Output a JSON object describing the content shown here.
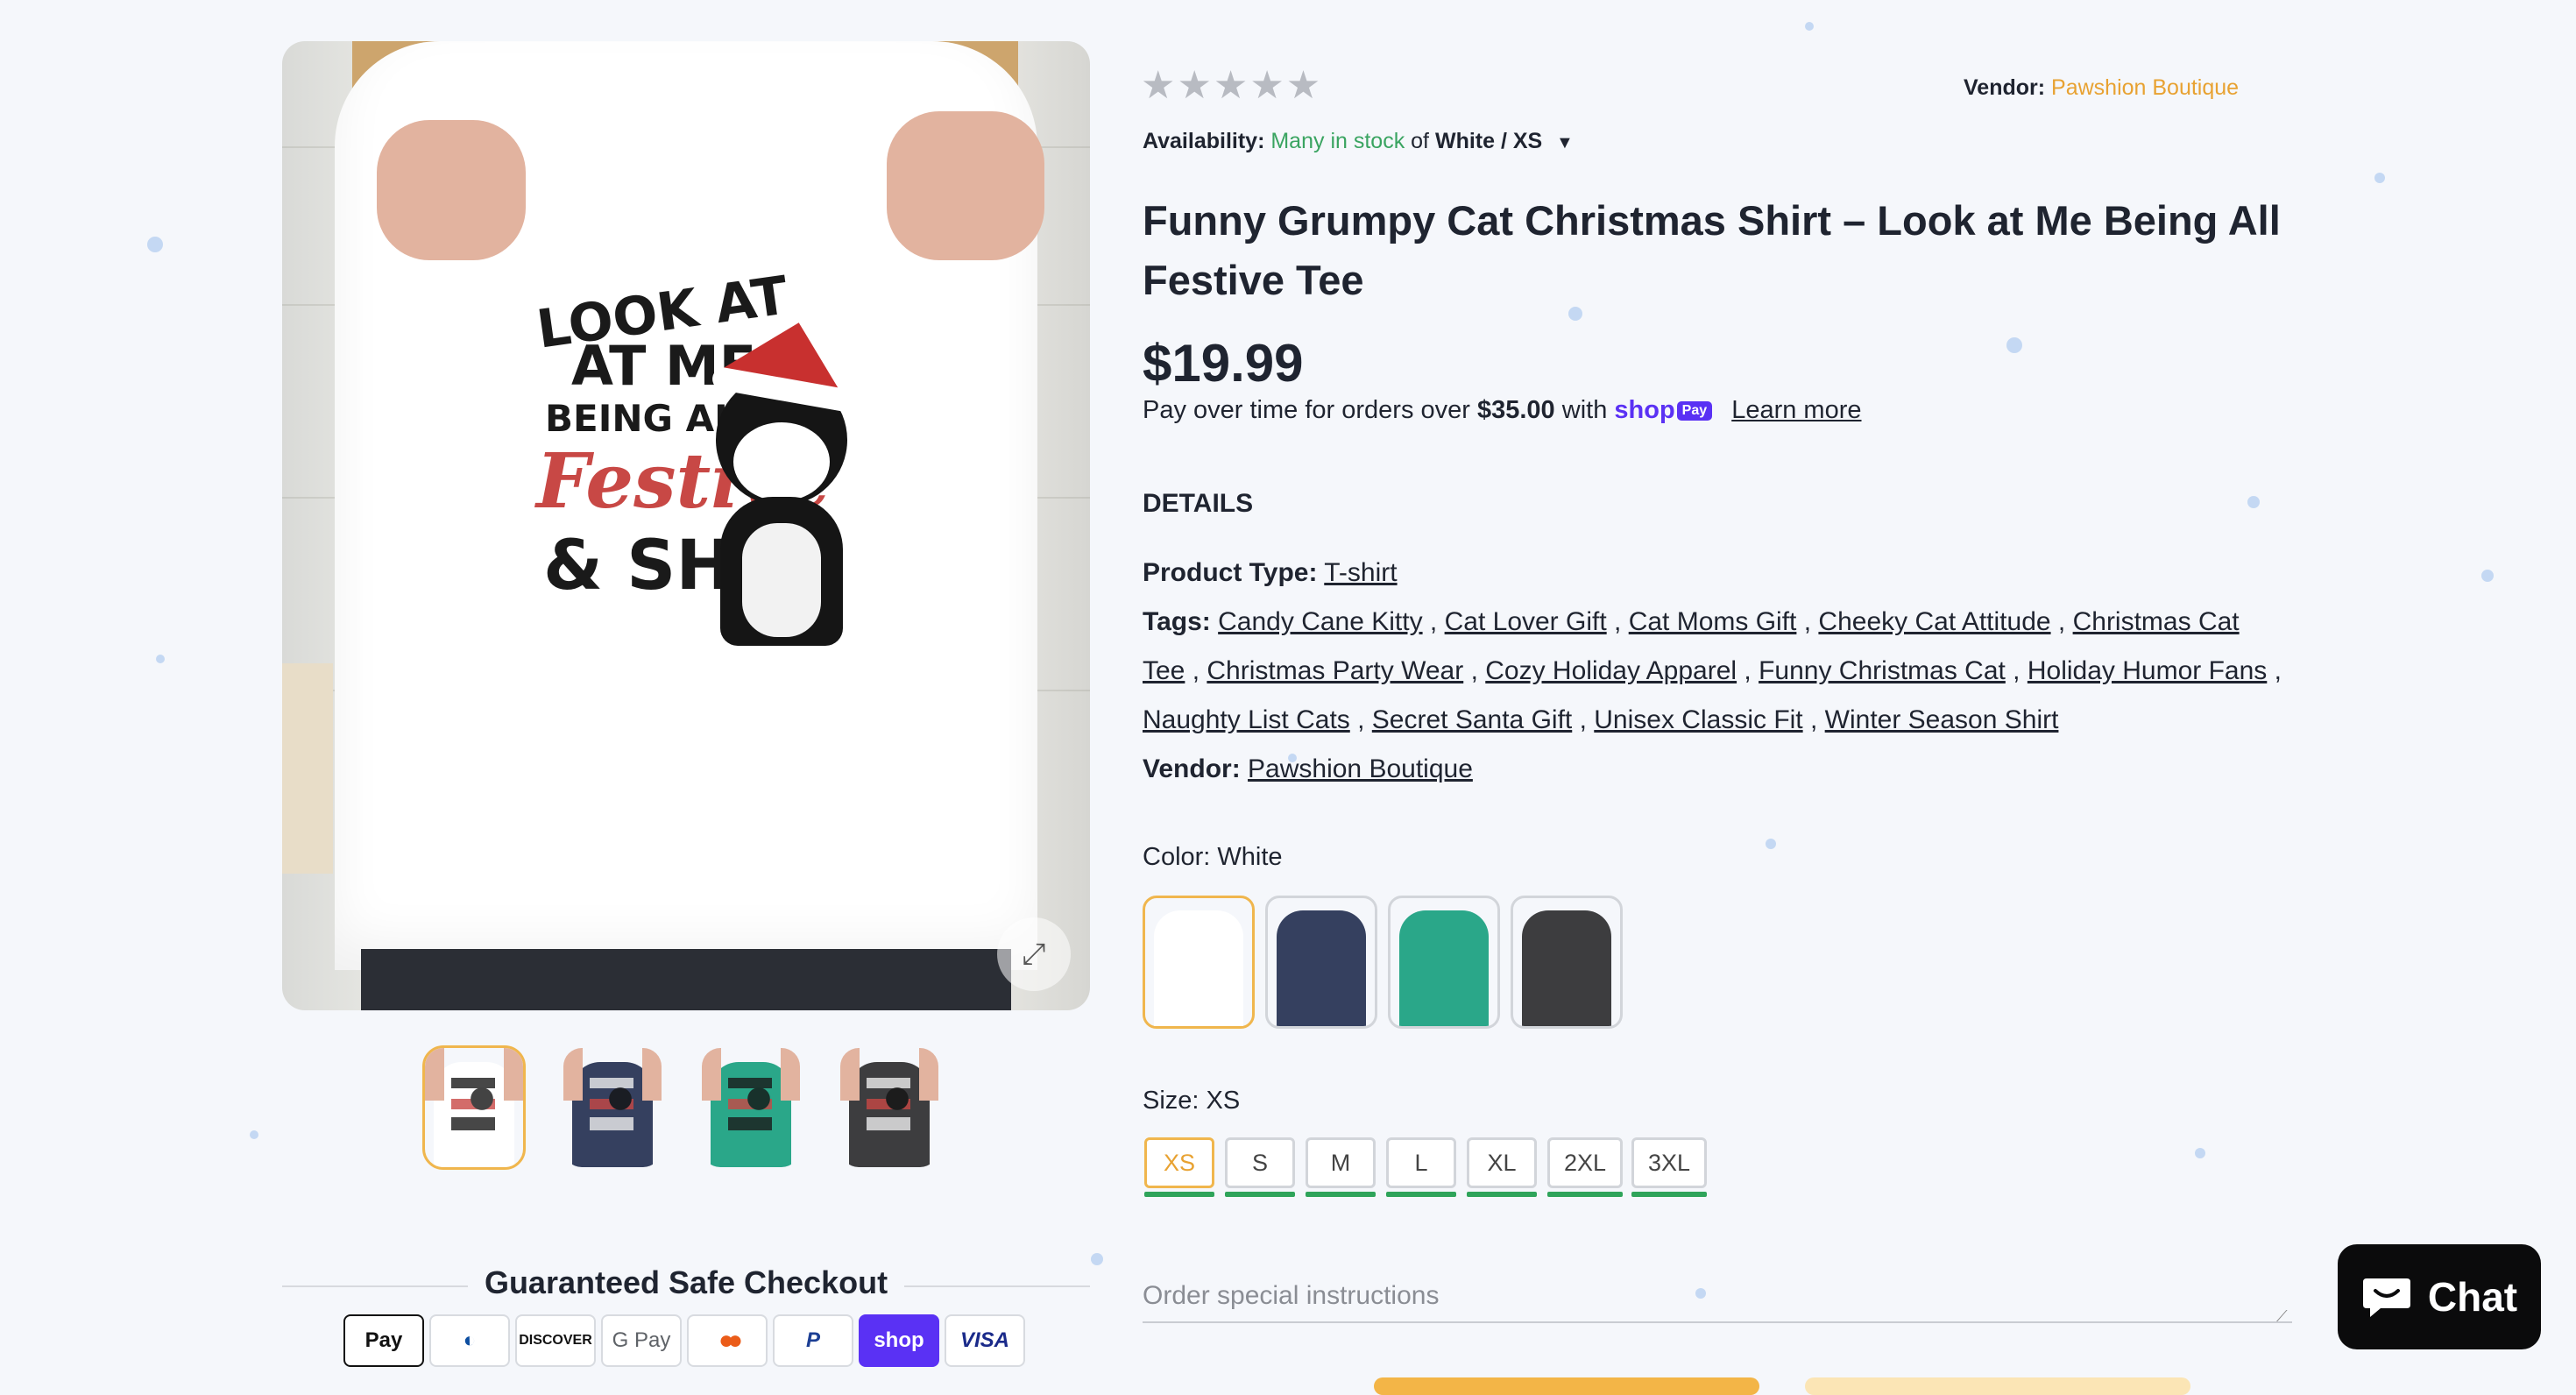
{
  "gallery": {
    "main_image_alt": "",
    "print_lines": [
      "LOOK AT",
      "AT ME",
      "BEING ALL",
      "Festive",
      "& SHIT"
    ],
    "expand_icon": "expand-icon",
    "thumbnails": [
      {
        "color": "#ffffff"
      },
      {
        "color": "#35405f"
      },
      {
        "color": "#2aa789"
      },
      {
        "color": "#3d3d3f"
      }
    ]
  },
  "checkout": {
    "title": "Guaranteed Safe Checkout",
    "methods": [
      {
        "label": " Pay",
        "icon": "apple-pay-icon"
      },
      {
        "label": "◐",
        "icon": "diners-club-icon"
      },
      {
        "label": "DISCOVER",
        "icon": "discover-icon"
      },
      {
        "label": "G Pay",
        "icon": "google-pay-icon"
      },
      {
        "label": "●●",
        "icon": "mastercard-icon"
      },
      {
        "label": "P",
        "icon": "paypal-icon"
      },
      {
        "label": "shop",
        "icon": "shop-pay-icon"
      },
      {
        "label": "VISA",
        "icon": "visa-icon"
      }
    ]
  },
  "product": {
    "stars": "★★★★★",
    "rating_fraction": 0,
    "vendor_label": "Vendor:",
    "vendor_name": "Pawshion Boutique",
    "availability_label": "Availability:",
    "availability_stock": "Many in stock",
    "availability_of": "of",
    "availability_variant": "White / XS",
    "title": "Funny Grumpy Cat Christmas Shirt – Look at Me Being All Festive Tee",
    "price": "$19.99",
    "installments_prefix": "Pay over time for orders over",
    "installments_amount": "$35.00",
    "installments_with": "with",
    "shop_pay_word": "shop",
    "shop_pay_badge": "Pay",
    "learn_more": "Learn more",
    "details_heading": "DETAILS",
    "product_type_label": "Product Type:",
    "product_type": "T-shirt",
    "tags_label": "Tags:",
    "tags": [
      "Candy Cane Kitty",
      "Cat Lover Gift",
      "Cat Moms Gift",
      "Cheeky Cat Attitude",
      "Christmas Cat Tee",
      "Christmas Party Wear",
      "Cozy Holiday Apparel",
      "Funny Christmas Cat",
      "Holiday Humor Fans",
      "Naughty List Cats",
      "Secret Santa Gift",
      "Unisex Classic Fit",
      "Winter Season Shirt"
    ],
    "vendor_detail_label": "Vendor:",
    "vendor_detail": "Pawshion Boutique",
    "color_label": "Color: White",
    "color_swatches": [
      {
        "color": "#ffffff",
        "selected": true
      },
      {
        "color": "#35405f",
        "selected": false
      },
      {
        "color": "#2aa789",
        "selected": false
      },
      {
        "color": "#3d3d3f",
        "selected": false
      }
    ],
    "size_label": "Size: XS",
    "sizes": [
      "XS",
      "S",
      "M",
      "L",
      "XL",
      "2XL",
      "3XL"
    ],
    "selected_size": "XS",
    "instructions_placeholder": "Order special instructions"
  },
  "chat": {
    "label": "Chat",
    "icon": "chat-bubble-icon"
  },
  "colors": {
    "accent": "#f0b64d",
    "vendor_link": "#e8a232",
    "stock_green": "#3aa461",
    "size_available": "#2fa45a",
    "shop_pay": "#5a31f4"
  }
}
